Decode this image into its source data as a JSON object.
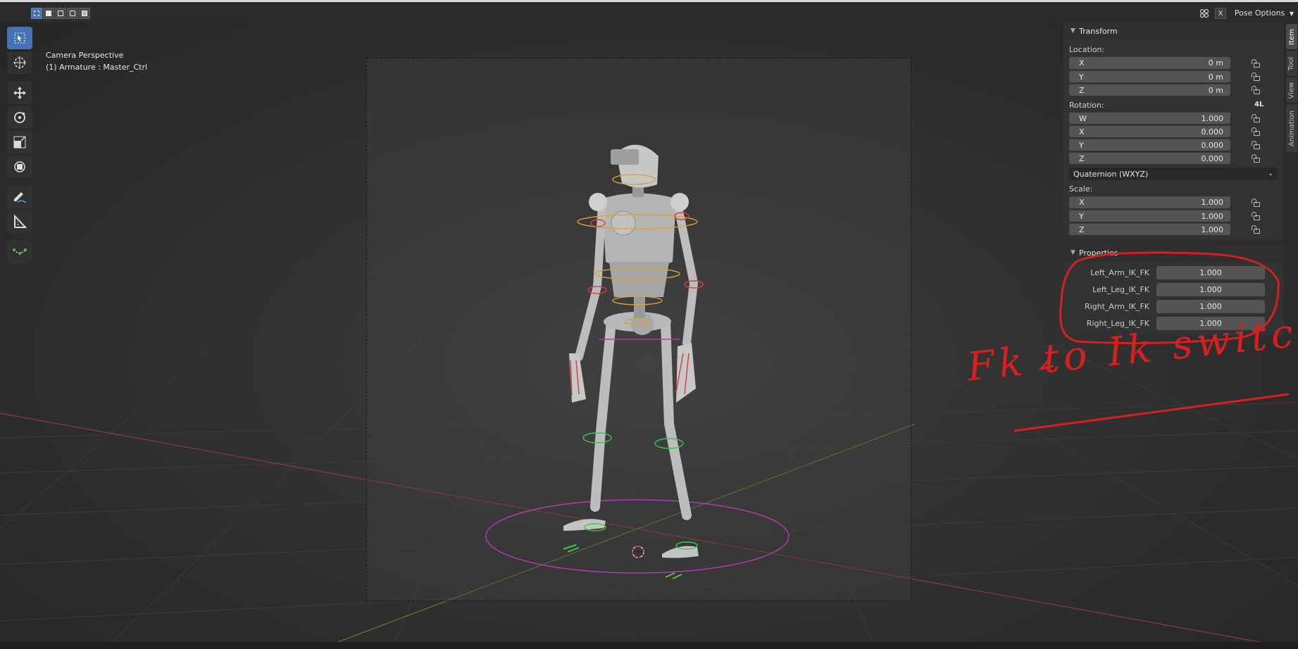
{
  "header": {
    "mode_buttons": [
      "select-box-icon",
      "select-extend-icon",
      "select-subtract-icon",
      "select-difference-icon",
      "select-intersect-icon"
    ],
    "pose_options_label": "Pose Options",
    "overlay_icon": "overlay-icon",
    "close_label": "X"
  },
  "viewport": {
    "title_line1": "Camera Perspective",
    "title_line2": "(1) Armature : Master_Ctrl"
  },
  "toolbar": {
    "tools": [
      "select-cursor-icon",
      "cursor-3d-icon",
      "move-icon",
      "rotate-icon",
      "scale-icon",
      "transform-icon",
      "annotate-icon",
      "measure-icon",
      "bone-roll-icon"
    ]
  },
  "transform_panel": {
    "title": "Transform",
    "location_label": "Location:",
    "location": [
      {
        "axis": "X",
        "value": "0 m"
      },
      {
        "axis": "Y",
        "value": "0 m"
      },
      {
        "axis": "Z",
        "value": "0 m"
      }
    ],
    "rotation_label": "Rotation:",
    "rotation_mode_badge": "4L",
    "rotation": [
      {
        "axis": "W",
        "value": "1.000"
      },
      {
        "axis": "X",
        "value": "0.000"
      },
      {
        "axis": "Y",
        "value": "0.000"
      },
      {
        "axis": "Z",
        "value": "0.000"
      }
    ],
    "rotation_mode": "Quaternion (WXYZ)",
    "scale_label": "Scale:",
    "scale": [
      {
        "axis": "X",
        "value": "1.000"
      },
      {
        "axis": "Y",
        "value": "1.000"
      },
      {
        "axis": "Z",
        "value": "1.000"
      }
    ]
  },
  "properties_panel": {
    "title": "Properties",
    "items": [
      {
        "label": "Left_Arm_IK_FK",
        "value": "1.000"
      },
      {
        "label": "Left_Leg_IK_FK",
        "value": "1.000"
      },
      {
        "label": "Right_Arm_IK_FK",
        "value": "1.000"
      },
      {
        "label": "Right_Leg_IK_FK",
        "value": "1.000"
      }
    ]
  },
  "side_tabs": [
    "Item",
    "Tool",
    "View",
    "Animation"
  ],
  "annotation": {
    "text": "Fk to Ik switch",
    "color": "#d42020"
  },
  "colors": {
    "accent": "#4772b3",
    "bone_green": "#3ec84a",
    "bone_orange": "#d9a23a",
    "bone_red": "#d84040",
    "root_magenta": "#b03ab0",
    "axis_red": "#b34040",
    "axis_green": "#6f9a3a"
  }
}
